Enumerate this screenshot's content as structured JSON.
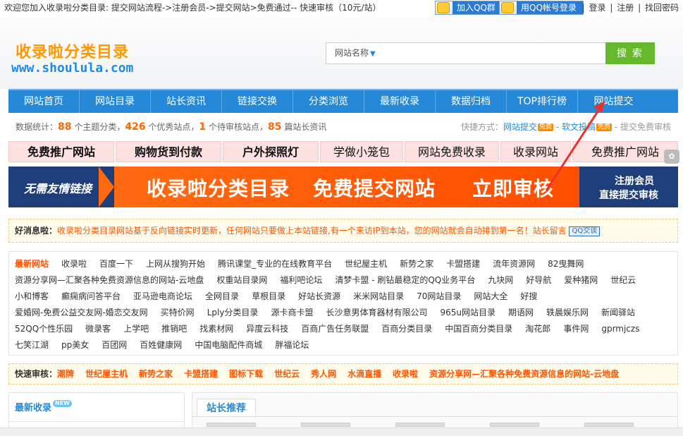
{
  "topbar": {
    "notice": "欢迎您加入收录啦分类目录: 提交网站流程->注册会员->提交网站>免费通过-- 快速审核（10元/站）",
    "qq_group": "加入QQ群",
    "qq_login": "用QQ帐号登录",
    "login": "登录",
    "register": "注册",
    "forgot": "找回密码",
    "sep": "|"
  },
  "logo": {
    "cn": "收录啦分类目录",
    "en": "www.shoulula.com"
  },
  "search": {
    "type": "网站名称",
    "placeholder": "",
    "button": "搜 索"
  },
  "nav": [
    "网站首页",
    "网站目录",
    "站长资讯",
    "链接交换",
    "分类浏览",
    "最新收录",
    "数据归档",
    "TOP排行榜",
    "网站提交"
  ],
  "stats": {
    "prefix": "数据统计：",
    "categories": "88",
    "categories_label": "个主题分类，",
    "quality": "426",
    "quality_label": "个优秀站点，",
    "pending": "1",
    "pending_label": "个待审核站点，",
    "news": "85",
    "news_label": "篇站长资讯",
    "shortcut_label": "快捷方式：",
    "shortcut1": "网站提交",
    "shortcut2": "软文投稿",
    "shortcut3": "提交免费审核",
    "badge": "免费",
    "dash": " - "
  },
  "adstrip": [
    "免费推广网站",
    "购物货到付款",
    "户外探照灯",
    "学做小笼包",
    "网站免费收录",
    "收录网站",
    "免费推广网站"
  ],
  "banner": {
    "left": "无需友情链接",
    "m1": "收录啦分类目录",
    "m2": "免费提交网站",
    "m3": "立即审核",
    "r1": "注册会员",
    "r2": "直接提交审核"
  },
  "goodnews": {
    "label": "好消息啦：",
    "text": "收录啦分类目录网站基于反向链接实时更新，任何网站只要做上本站链接,有一个来访IP到本站，您的网站就会自动排到第一名！站长留言",
    "qq": "QQ交谈"
  },
  "links": [
    [
      "最新网站",
      "收录啦",
      "百度一下",
      "上网从搜狗开始",
      "腾讯课堂_专业的在线教育平台",
      "世纪屋主机",
      "新势之家",
      "卡盟搭建",
      "流年资源网",
      "82曳舞网"
    ],
    [
      "资源分享网—汇聚各种免费资源信息的网站-云地盘",
      "权重站目录网",
      "福利吧论坛",
      "清梦卡盟 - 刷钻最稳定的QQ业务平台",
      "九块网",
      "好导航",
      "爱种猪网",
      "世纪云"
    ],
    [
      "小和博客",
      "癫痫病问答平台",
      "亚马逊电商论坛",
      "全网目录",
      "草根目录",
      "好站长资源",
      "米米网站目录",
      "70网站目录",
      "网站大全",
      "好搜"
    ],
    [
      "爱婚网-免费公益交友网-婚恋交友网",
      "买特价网",
      "Lply分类目录",
      "源卡商卡盟",
      "长沙意男体育器材有限公司",
      "965u网站目录",
      "期语网",
      "轶晨娱乐网",
      "新闻驿站"
    ],
    [
      "52QQ个性乐园",
      "微录客",
      "上学吧",
      "推销吧",
      "找素材网",
      "异度云科技",
      "百商广告任务联盟",
      "百商分类目录",
      "中国百商分类目录",
      "淘花郎",
      "事件网",
      "gprmjczs"
    ],
    [
      "七笑江湖",
      "pp美女",
      "百团网",
      "百姓健康网",
      "中国电脑配件商城",
      "胖福论坛"
    ]
  ],
  "quick": {
    "label": "快速审核：",
    "items": [
      "潮牌",
      "世纪屋主机",
      "新势之家",
      "卡盟搭建",
      "图标下载",
      "世纪云",
      "秀人网",
      "水滴直播",
      "收录啦",
      "资源分享网—汇聚各种免费资源信息的网站-云地盘"
    ]
  },
  "panel_left": {
    "title": "最新收录",
    "badge": "NEW"
  },
  "panel_right": {
    "tab": "站长推荐"
  },
  "colors": {
    "nav": "#2688d9",
    "accent": "#ff6600",
    "search_btn": "#65b82c"
  }
}
